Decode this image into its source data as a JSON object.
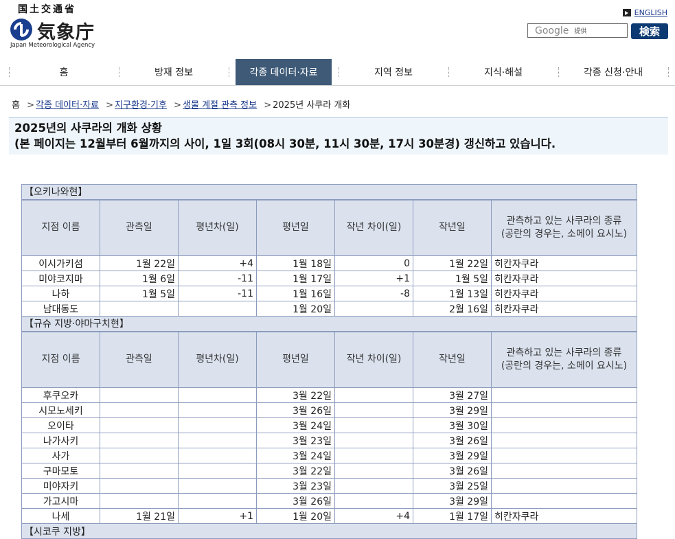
{
  "header": {
    "logo_top": "国土交通省",
    "logo_name": "気象庁",
    "logo_sub": "Japan Meteorological Agency",
    "english_link": "ENGLISH",
    "search_placeholder_brand": "Google",
    "search_placeholder_suffix": "提供",
    "search_button": "検索"
  },
  "nav": {
    "items": [
      {
        "label": "홈"
      },
      {
        "label": "방재 정보"
      },
      {
        "label": "각종 데이터·자료"
      },
      {
        "label": "지역 정보"
      },
      {
        "label": "지식·해설"
      },
      {
        "label": "각종 신청·안내"
      }
    ],
    "active_index": 2
  },
  "breadcrumb": {
    "home": "홈",
    "links": [
      "각종 데이터·자료",
      "지구환경·기후",
      "생물 계절 관측 정보"
    ],
    "current": "2025년 사쿠라 개화"
  },
  "title": {
    "line1": "2025년의 사쿠라의 개화 상황",
    "line2": "(본 페이지는 12월부터 6월까지의 사이, 1일 3회(08시 30분, 11시 30분, 17시 30분경) 갱신하고 있습니다."
  },
  "table": {
    "columns": [
      "지점 이름",
      "관측일",
      "평년차(일)",
      "평년일",
      "작년 차이(일)",
      "작년일",
      "관측하고 있는 사쿠라의 종류\n(공란의 경우는, 소메이 요시노)"
    ],
    "regions": [
      {
        "name": "【오키나와현】",
        "rows": [
          [
            "이시가키섬",
            "1월 22일",
            "+4",
            "1월 18일",
            "0",
            "1월 22일",
            "히칸자쿠라"
          ],
          [
            "미야코지마",
            "1월 6일",
            "-11",
            "1월 17일",
            "+1",
            "1월 5일",
            "히칸자쿠라"
          ],
          [
            "나하",
            "1월 5일",
            "-11",
            "1월 16일",
            "-8",
            "1월 13일",
            "히칸자쿠라"
          ],
          [
            "남대동도",
            "",
            "",
            "1월 20일",
            "",
            "2월 16일",
            "히칸자쿠라"
          ]
        ]
      },
      {
        "name": "【규슈 지방·야마구치현】",
        "rows": [
          [
            "후쿠오카",
            "",
            "",
            "3월 22일",
            "",
            "3월 27일",
            ""
          ],
          [
            "시모노세키",
            "",
            "",
            "3월 26일",
            "",
            "3월 29일",
            ""
          ],
          [
            "오이타",
            "",
            "",
            "3월 24일",
            "",
            "3월 30일",
            ""
          ],
          [
            "나가사키",
            "",
            "",
            "3월 23일",
            "",
            "3월 26일",
            ""
          ],
          [
            "사가",
            "",
            "",
            "3월 24일",
            "",
            "3월 29일",
            ""
          ],
          [
            "구마모토",
            "",
            "",
            "3월 22일",
            "",
            "3월 26일",
            ""
          ],
          [
            "미야자키",
            "",
            "",
            "3월 23일",
            "",
            "3월 25일",
            ""
          ],
          [
            "가고시마",
            "",
            "",
            "3월 26일",
            "",
            "3월 29일",
            ""
          ],
          [
            "나세",
            "1월 21일",
            "+1",
            "1월 20일",
            "+4",
            "1월 17일",
            "히칸자쿠라"
          ]
        ]
      },
      {
        "name": "【시코쿠 지방】",
        "rows": []
      }
    ]
  },
  "colors": {
    "nav_active": "#3e5a77",
    "table_header_bg": "#dbe2ee",
    "table_border": "#8d9cbd",
    "title_bg": "#eef5fb",
    "link": "#1a3a8c",
    "search_button_bg": "#0d3a72"
  }
}
